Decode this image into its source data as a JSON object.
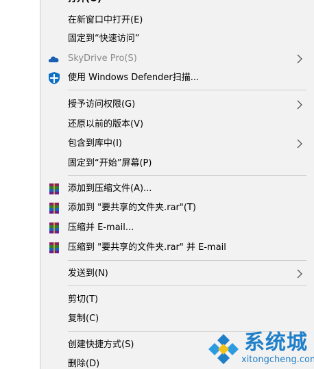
{
  "menu": {
    "partial_top": "打开(O)",
    "items": [
      {
        "label": "在新窗口中打开(E)"
      },
      {
        "label": "固定到“快速访问”"
      },
      {
        "label": "SkyDrive Pro(S)",
        "icon": "cloud-icon",
        "submenu": true,
        "disabled": true
      },
      {
        "label": "使用 Windows Defender扫描...",
        "icon": "defender-shield-icon"
      },
      {
        "label": "授予访问权限(G)",
        "submenu": true
      },
      {
        "label": "还原以前的版本(V)"
      },
      {
        "label": "包含到库中(I)",
        "submenu": true
      },
      {
        "label": "固定到“开始”屏幕(P)"
      },
      {
        "label": "添加到压缩文件(A)...",
        "icon": "winrar-icon"
      },
      {
        "label": "添加到 \"要共享的文件夹.rar\"(T)",
        "icon": "winrar-icon"
      },
      {
        "label": "压缩并 E-mail...",
        "icon": "winrar-icon"
      },
      {
        "label": "压缩到 \"要共享的文件夹.rar\" 并 E-mail",
        "icon": "winrar-icon"
      },
      {
        "label": "发送到(N)",
        "submenu": true
      },
      {
        "label": "剪切(T)"
      },
      {
        "label": "复制(C)"
      },
      {
        "label": "创建快捷方式(S)"
      },
      {
        "label": "删除(D)"
      }
    ]
  },
  "watermark": {
    "brand": "系统城",
    "url": "xitongcheng.com"
  },
  "colors": {
    "menu_bg": "#f2f2f2",
    "separator": "#cfcfcf",
    "disabled_text": "#8a8a8a",
    "watermark_blue": "#1f7fc9",
    "defender_blue": "#0b6fc6"
  }
}
